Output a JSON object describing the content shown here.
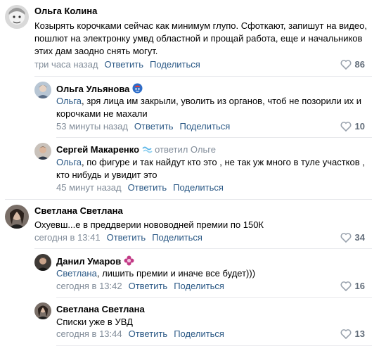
{
  "comments": [
    {
      "author": "Ольга Колина",
      "text": "Козырять корочками сейчас как минимум глупо. Сфоткают, запишут на видео, пошлют на электронку умвд областной и прощай работа, еще и начальников этих дам заодно снять могут.",
      "time": "три часа назад",
      "reply": "Ответить",
      "share": "Поделиться",
      "likes": "86",
      "replies": [
        {
          "author": "Ольга Ульянова",
          "mention": "Ольга",
          "text": ", зря лица им закрыли, уволить из органов, чтоб не позорили их и корочками не махали",
          "time": "53 минуты назад",
          "reply": "Ответить",
          "share": "Поделиться",
          "likes": "10"
        },
        {
          "author": "Сергей Макаренко",
          "replied_to": "ответил Ольге",
          "mention": "Ольга",
          "text": ", по фигуре и так найдут кто это , не так уж много в туле участков , кто нибудь и увидит это",
          "time": "45 минут назад",
          "reply": "Ответить",
          "share": "Поделиться"
        }
      ]
    },
    {
      "author": "Светлана Светлана",
      "text": "Охуевш...е в преддверии нововодней премии по 150К",
      "time": "сегодня в 13:41",
      "reply": "Ответить",
      "share": "Поделиться",
      "likes": "34",
      "replies": [
        {
          "author": "Данил Умаров",
          "mention": "Светлана",
          "text": ", лишить премии и иначе все будет)))",
          "time": "сегодня в 13:42",
          "reply": "Ответить",
          "share": "Поделиться",
          "likes": "16"
        },
        {
          "author": "Светлана Светлана",
          "text": "Списки уже в УВД",
          "time": "сегодня в 13:44",
          "reply": "Ответить",
          "share": "Поделиться",
          "likes": "13"
        }
      ]
    }
  ]
}
